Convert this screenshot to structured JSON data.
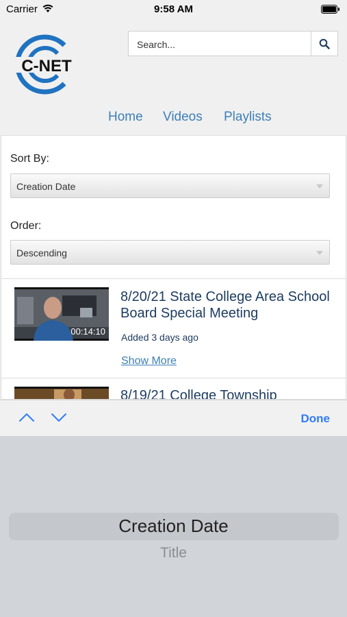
{
  "status_bar": {
    "carrier": "Carrier",
    "time": "9:58 AM"
  },
  "header": {
    "logo_text": "C-NET",
    "search_placeholder": "Search...",
    "nav": [
      "Home",
      "Videos",
      "Playlists"
    ]
  },
  "filters": {
    "sort_label": "Sort By:",
    "sort_value": "Creation Date",
    "order_label": "Order:",
    "order_value": "Descending"
  },
  "videos": [
    {
      "title": "8/20/21 State College Area School Board Special Meeting",
      "duration": "00:14:10",
      "added": "Added 3 days ago",
      "show_more": "Show More"
    },
    {
      "title": "8/19/21 College Township"
    }
  ],
  "toolbar": {
    "done_label": "Done"
  },
  "picker": {
    "options": [
      "Creation Date",
      "Title"
    ]
  },
  "colors": {
    "accent": "#3d7fb6",
    "title": "#1d3c60",
    "done": "#2f7cf6",
    "logo": "#1f73c0"
  }
}
